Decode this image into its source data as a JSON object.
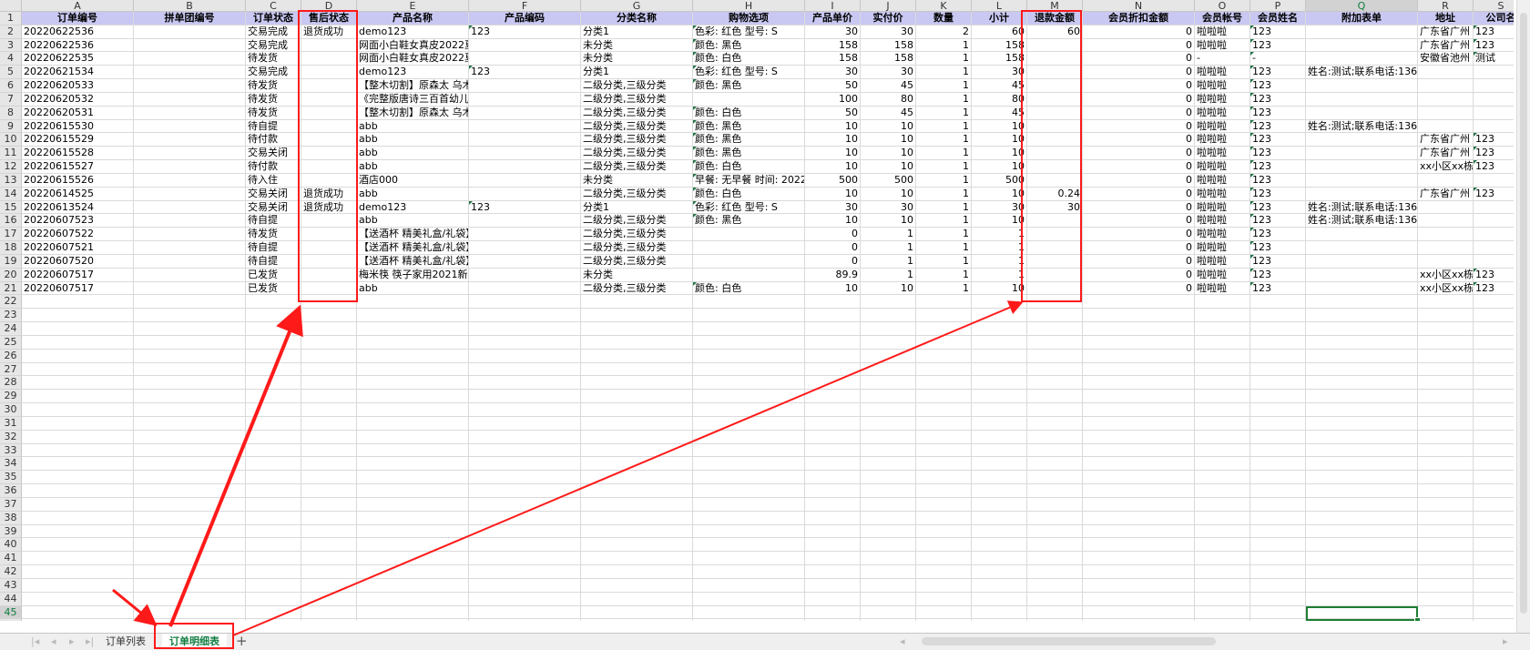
{
  "columns": [
    {
      "letter": "A"
    },
    {
      "letter": "B"
    },
    {
      "letter": "C"
    },
    {
      "letter": "D"
    },
    {
      "letter": "E"
    },
    {
      "letter": "F"
    },
    {
      "letter": "G"
    },
    {
      "letter": "H"
    },
    {
      "letter": "I"
    },
    {
      "letter": "J"
    },
    {
      "letter": "K"
    },
    {
      "letter": "L"
    },
    {
      "letter": "M"
    },
    {
      "letter": "N"
    },
    {
      "letter": "O"
    },
    {
      "letter": "P"
    },
    {
      "letter": "Q"
    },
    {
      "letter": "R"
    },
    {
      "letter": "S"
    }
  ],
  "header_row": [
    "订单编号",
    "拼单团编号",
    "订单状态",
    "售后状态",
    "产品名称",
    "产品编码",
    "分类名称",
    "购物选项",
    "产品单价",
    "实付价",
    "数量",
    "小计",
    "退款金额",
    "会员折扣金额",
    "会员帐号",
    "会员姓名",
    "附加表单",
    "地址",
    "公司名"
  ],
  "rows": [
    [
      "20220622536",
      "",
      "交易完成",
      "退货成功",
      "demo123",
      "123",
      "分类1",
      "色彩: 红色 型号: S",
      "30",
      "30",
      "2",
      "60",
      "60",
      "0",
      "啦啦啦",
      "123",
      "",
      "广东省广州",
      "123"
    ],
    [
      "20220622536",
      "",
      "交易完成",
      "",
      "网面小白鞋女真皮2022夏",
      "",
      "未分类",
      "颜色: 黑色",
      "158",
      "158",
      "1",
      "158",
      "",
      "0",
      "啦啦啦",
      "123",
      "",
      "广东省广州",
      "123"
    ],
    [
      "20220622535",
      "",
      "待发货",
      "",
      "网面小白鞋女真皮2022夏",
      "",
      "未分类",
      "颜色: 白色",
      "158",
      "158",
      "1",
      "158",
      "",
      "0",
      "-",
      "-",
      "",
      "安徽省池州",
      "测试"
    ],
    [
      "20220621534",
      "",
      "交易完成",
      "",
      "demo123",
      "123",
      "分类1",
      "色彩: 红色 型号: S",
      "30",
      "30",
      "1",
      "30",
      "",
      "0",
      "啦啦啦",
      "123",
      "姓名:测试;联系电话:136",
      "",
      ""
    ],
    [
      "20220620533",
      "",
      "待发货",
      "",
      "【整木切割】原森太 乌木",
      "",
      "二级分类,三级分类",
      "颜色: 黑色",
      "50",
      "45",
      "1",
      "45",
      "",
      "0",
      "啦啦啦",
      "123",
      "",
      "",
      ""
    ],
    [
      "20220620532",
      "",
      "待发货",
      "",
      "《完整版唐诗三百首幼儿",
      "",
      "二级分类,三级分类",
      "",
      "100",
      "80",
      "1",
      "80",
      "",
      "0",
      "啦啦啦",
      "123",
      "",
      "",
      ""
    ],
    [
      "20220620531",
      "",
      "待发货",
      "",
      "【整木切割】原森太 乌木",
      "",
      "二级分类,三级分类",
      "颜色: 白色",
      "50",
      "45",
      "1",
      "45",
      "",
      "0",
      "啦啦啦",
      "123",
      "",
      "",
      ""
    ],
    [
      "20220615530",
      "",
      "待自提",
      "",
      "abb",
      "",
      "二级分类,三级分类",
      "颜色: 黑色",
      "10",
      "10",
      "1",
      "10",
      "",
      "0",
      "啦啦啦",
      "123",
      "姓名:测试;联系电话:136",
      "",
      ""
    ],
    [
      "20220615529",
      "",
      "待付款",
      "",
      "abb",
      "",
      "二级分类,三级分类",
      "颜色: 黑色",
      "10",
      "10",
      "1",
      "10",
      "",
      "0",
      "啦啦啦",
      "123",
      "",
      "广东省广州",
      "123"
    ],
    [
      "20220615528",
      "",
      "交易关闭",
      "",
      "abb",
      "",
      "二级分类,三级分类",
      "颜色: 黑色",
      "10",
      "10",
      "1",
      "10",
      "",
      "0",
      "啦啦啦",
      "123",
      "",
      "广东省广州",
      "123"
    ],
    [
      "20220615527",
      "",
      "待付款",
      "",
      "abb",
      "",
      "二级分类,三级分类",
      "颜色: 白色",
      "10",
      "10",
      "1",
      "10",
      "",
      "0",
      "啦啦啦",
      "123",
      "",
      "xx小区xx栋",
      "123"
    ],
    [
      "20220615526",
      "",
      "待入住",
      "",
      "酒店000",
      "",
      "未分类",
      "早餐: 无早餐 时间: 2022",
      "500",
      "500",
      "1",
      "500",
      "",
      "0",
      "啦啦啦",
      "123",
      "",
      "",
      ""
    ],
    [
      "20220614525",
      "",
      "交易关闭",
      "退货成功",
      "abb",
      "",
      "二级分类,三级分类",
      "颜色: 白色",
      "10",
      "10",
      "1",
      "10",
      "0.24",
      "0",
      "啦啦啦",
      "123",
      "",
      "广东省广州",
      "123"
    ],
    [
      "20220613524",
      "",
      "交易关闭",
      "退货成功",
      "demo123",
      "123",
      "分类1",
      "色彩: 红色 型号: S",
      "30",
      "30",
      "1",
      "30",
      "30",
      "0",
      "啦啦啦",
      "123",
      "姓名:测试;联系电话:136",
      "",
      ""
    ],
    [
      "20220607523",
      "",
      "待自提",
      "",
      "abb",
      "",
      "二级分类,三级分类",
      "颜色: 黑色",
      "10",
      "10",
      "1",
      "10",
      "",
      "0",
      "啦啦啦",
      "123",
      "姓名:测试;联系电话:136",
      "",
      ""
    ],
    [
      "20220607522",
      "",
      "待发货",
      "",
      "【送酒杯 精美礼盒/礼袋】",
      "",
      "二级分类,三级分类",
      "",
      "0",
      "1",
      "1",
      "1",
      "",
      "0",
      "啦啦啦",
      "123",
      "",
      "",
      ""
    ],
    [
      "20220607521",
      "",
      "待自提",
      "",
      "【送酒杯 精美礼盒/礼袋】",
      "",
      "二级分类,三级分类",
      "",
      "0",
      "1",
      "1",
      "1",
      "",
      "0",
      "啦啦啦",
      "123",
      "",
      "",
      ""
    ],
    [
      "20220607520",
      "",
      "待自提",
      "",
      "【送酒杯 精美礼盒/礼袋】",
      "",
      "二级分类,三级分类",
      "",
      "0",
      "1",
      "1",
      "1",
      "",
      "0",
      "啦啦啦",
      "123",
      "",
      "",
      ""
    ],
    [
      "20220607517",
      "",
      "已发货",
      "",
      "梅米筷 筷子家用2021新款",
      "",
      "未分类",
      "",
      "89.9",
      "1",
      "1",
      "1",
      "",
      "0",
      "啦啦啦",
      "123",
      "",
      "xx小区xx栋",
      "123"
    ],
    [
      "20220607517",
      "",
      "已发货",
      "",
      "abb",
      "",
      "二级分类,三级分类",
      "颜色: 白色",
      "10",
      "10",
      "1",
      "10",
      "",
      "0",
      "啦啦啦",
      "123",
      "",
      "xx小区xx栋",
      "123"
    ]
  ],
  "tabs": [
    {
      "label": "订单列表",
      "active": false
    },
    {
      "label": "订单明细表",
      "active": true
    }
  ],
  "add_tab_label": "+",
  "selected_cell": "Q45",
  "colors": {
    "header_fill": "#c9c8f2",
    "annotation": "#ff1a1a",
    "active_tab": "#107c41"
  }
}
